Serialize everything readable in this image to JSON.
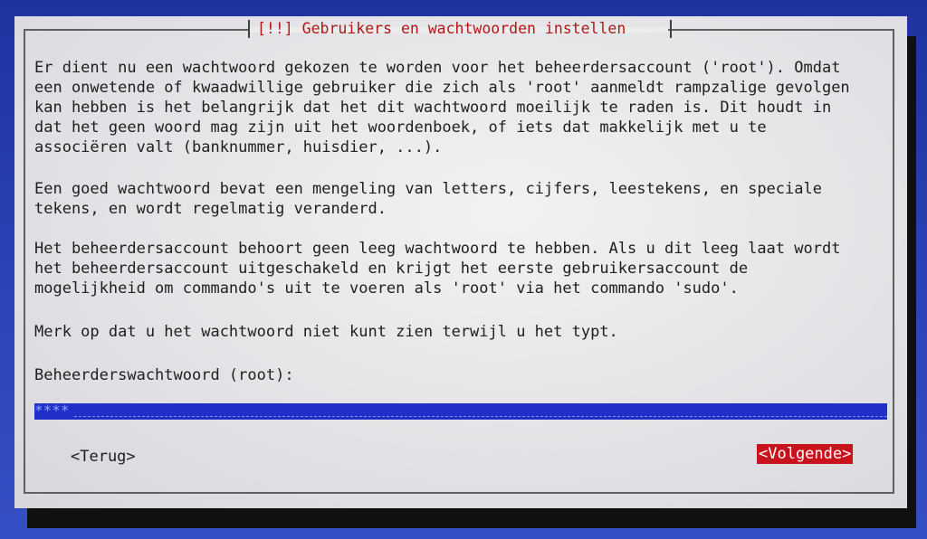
{
  "colors": {
    "background": "#2a3fa8",
    "dialog": "#e4e4e4",
    "title_text": "#b01818",
    "input_bg": "#1f2fc8",
    "primary_button_bg": "#c8121c",
    "primary_button_text": "#ffffff"
  },
  "dialog": {
    "title": "[!!] Gebruikers en wachtwoorden instellen",
    "paragraphs": [
      "Er dient nu een wachtwoord gekozen te worden voor het beheerdersaccount ('root'). Omdat\neen onwetende of kwaadwillige gebruiker die zich als 'root' aanmeldt rampzalige gevolgen\nkan hebben is het belangrijk dat het dit wachtwoord moeilijk te raden is. Dit houdt in\ndat het geen woord mag zijn uit het woordenboek, of iets dat makkelijk met u te\nassociëren valt (banknummer, huisdier, ...).",
      "Een goed wachtwoord bevat een mengeling van letters, cijfers, leestekens, en speciale\ntekens, en wordt regelmatig veranderd.",
      "Het beheerdersaccount behoort geen leeg wachtwoord te hebben. Als u dit leeg laat wordt\nhet beheerdersaccount uitgeschakeld en krijgt het eerste gebruikersaccount de\nmogelijkheid om commando's uit te voeren als 'root' via het commando 'sudo'.",
      "Merk op dat u het wachtwoord niet kunt zien terwijl u het typt."
    ],
    "field_label": "Beheerderswachtwoord (root):",
    "password_value": "****",
    "back_button": "<Terug>",
    "next_button": "<Volgende>"
  }
}
